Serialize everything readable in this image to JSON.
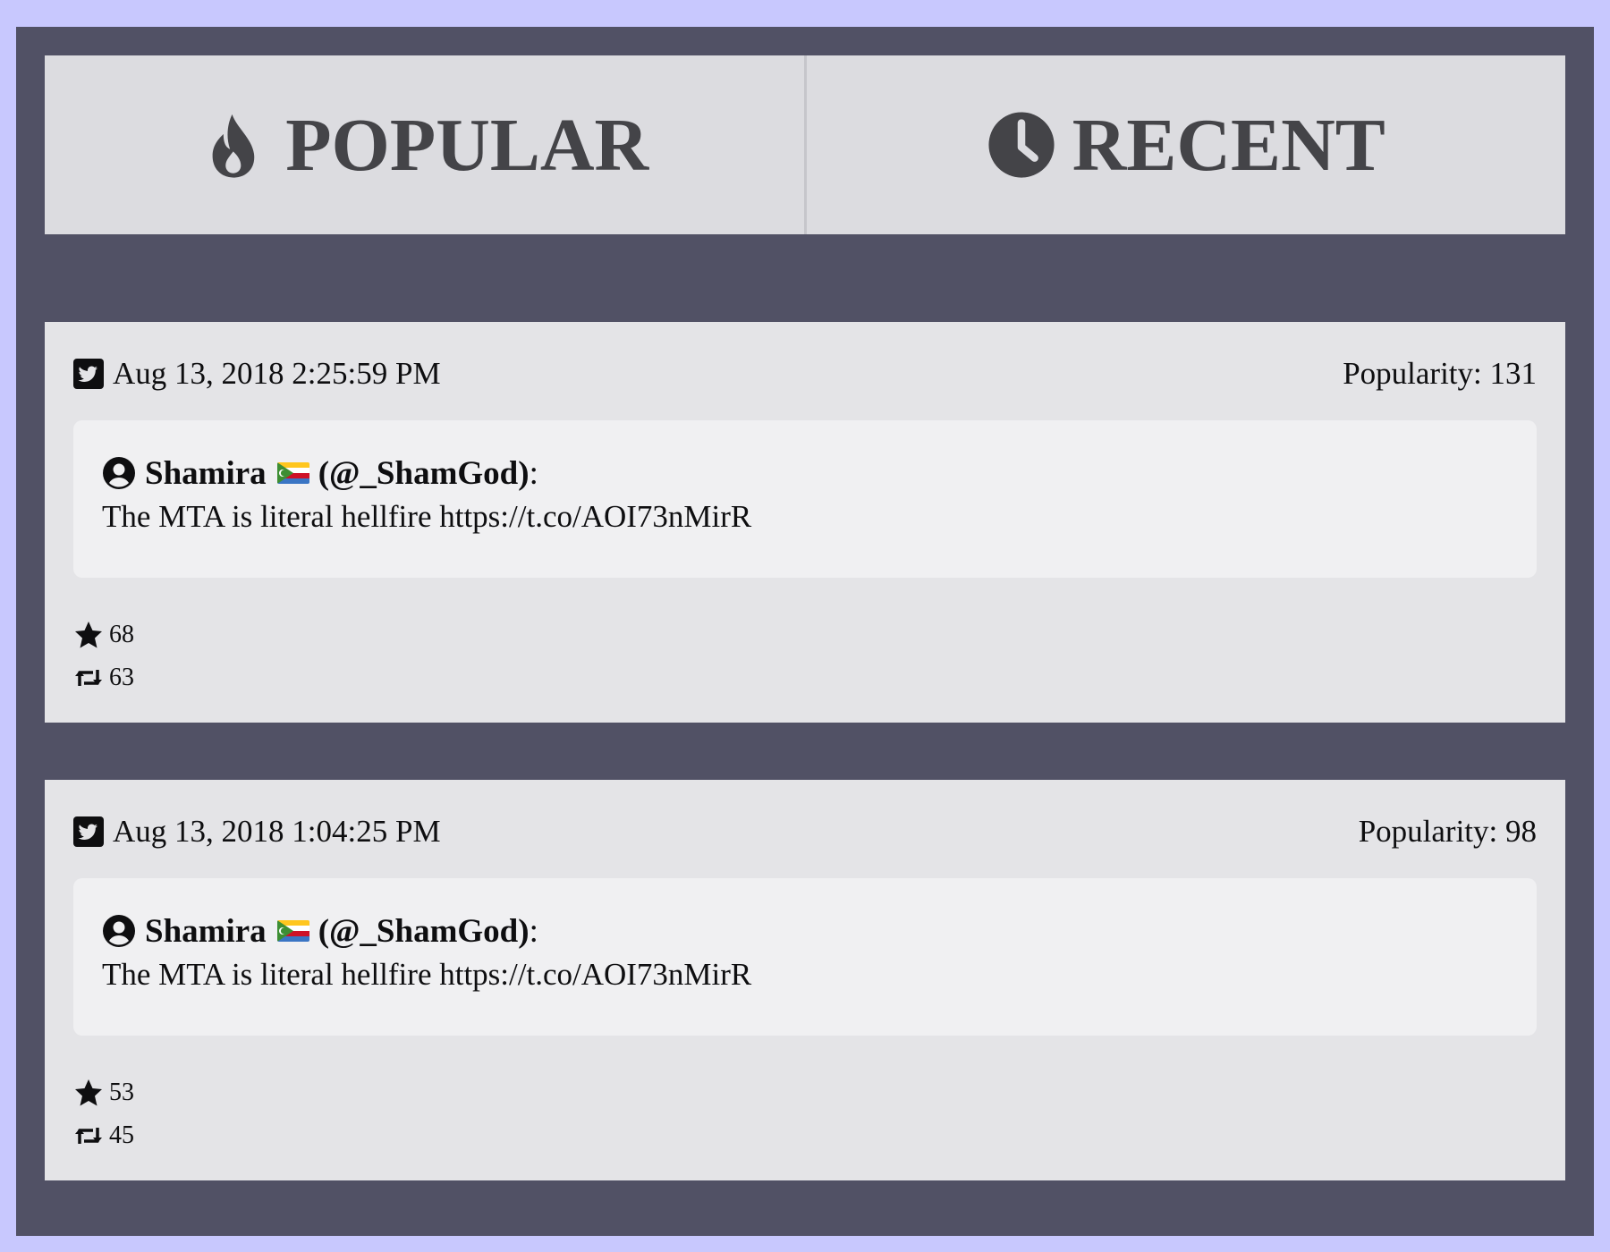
{
  "tabs": [
    {
      "label": "POPULAR",
      "icon": "fire-icon"
    },
    {
      "label": "RECENT",
      "icon": "clock-icon"
    }
  ],
  "colors": {
    "page_background": "#c8c8fe",
    "frame_background": "#515165",
    "tab_background": "#dcdce0",
    "tab_text": "#444448",
    "card_background": "#e4e4e7",
    "tweet_background": "#f0f0f2"
  },
  "tweets": [
    {
      "date": "Aug 13, 2018 2:25:59 PM",
      "popularity": "Popularity: 131",
      "author_name": "Shamira",
      "author_flag": "comoros-flag-icon",
      "author_handle": "(@_ShamGod)",
      "author_colon": ":",
      "text": "The MTA is literal hellfire https://t.co/AOI73nMirR",
      "favorites": "68",
      "retweets": "63"
    },
    {
      "date": "Aug 13, 2018 1:04:25 PM",
      "popularity": "Popularity: 98",
      "author_name": "Shamira",
      "author_flag": "comoros-flag-icon",
      "author_handle": "(@_ShamGod)",
      "author_colon": ":",
      "text": "The MTA is literal hellfire https://t.co/AOI73nMirR",
      "favorites": "53",
      "retweets": "45"
    }
  ]
}
